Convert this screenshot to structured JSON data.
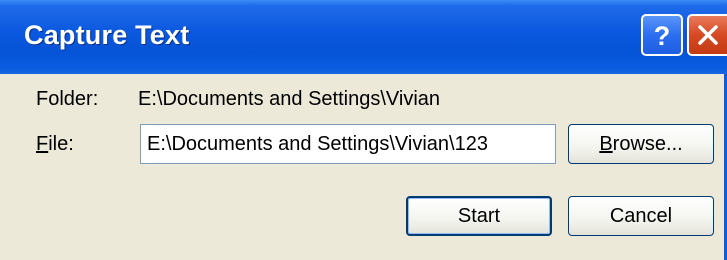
{
  "window": {
    "title": "Capture Text",
    "help_glyph": "?",
    "close_glyph": "✕",
    "colors": {
      "titlebar": "#0a58df",
      "close_button": "#d64a22",
      "dialog_background": "#ece9d8"
    }
  },
  "form": {
    "folder_label": "Folder:",
    "folder_value": "E:\\Documents and Settings\\Vivian",
    "file_label_accel": "F",
    "file_label_rest": "ile:",
    "file_value": "E:\\Documents and Settings\\Vivian\\123"
  },
  "buttons": {
    "browse_accel": "B",
    "browse_rest": "rowse...",
    "start": "Start",
    "cancel": "Cancel"
  }
}
